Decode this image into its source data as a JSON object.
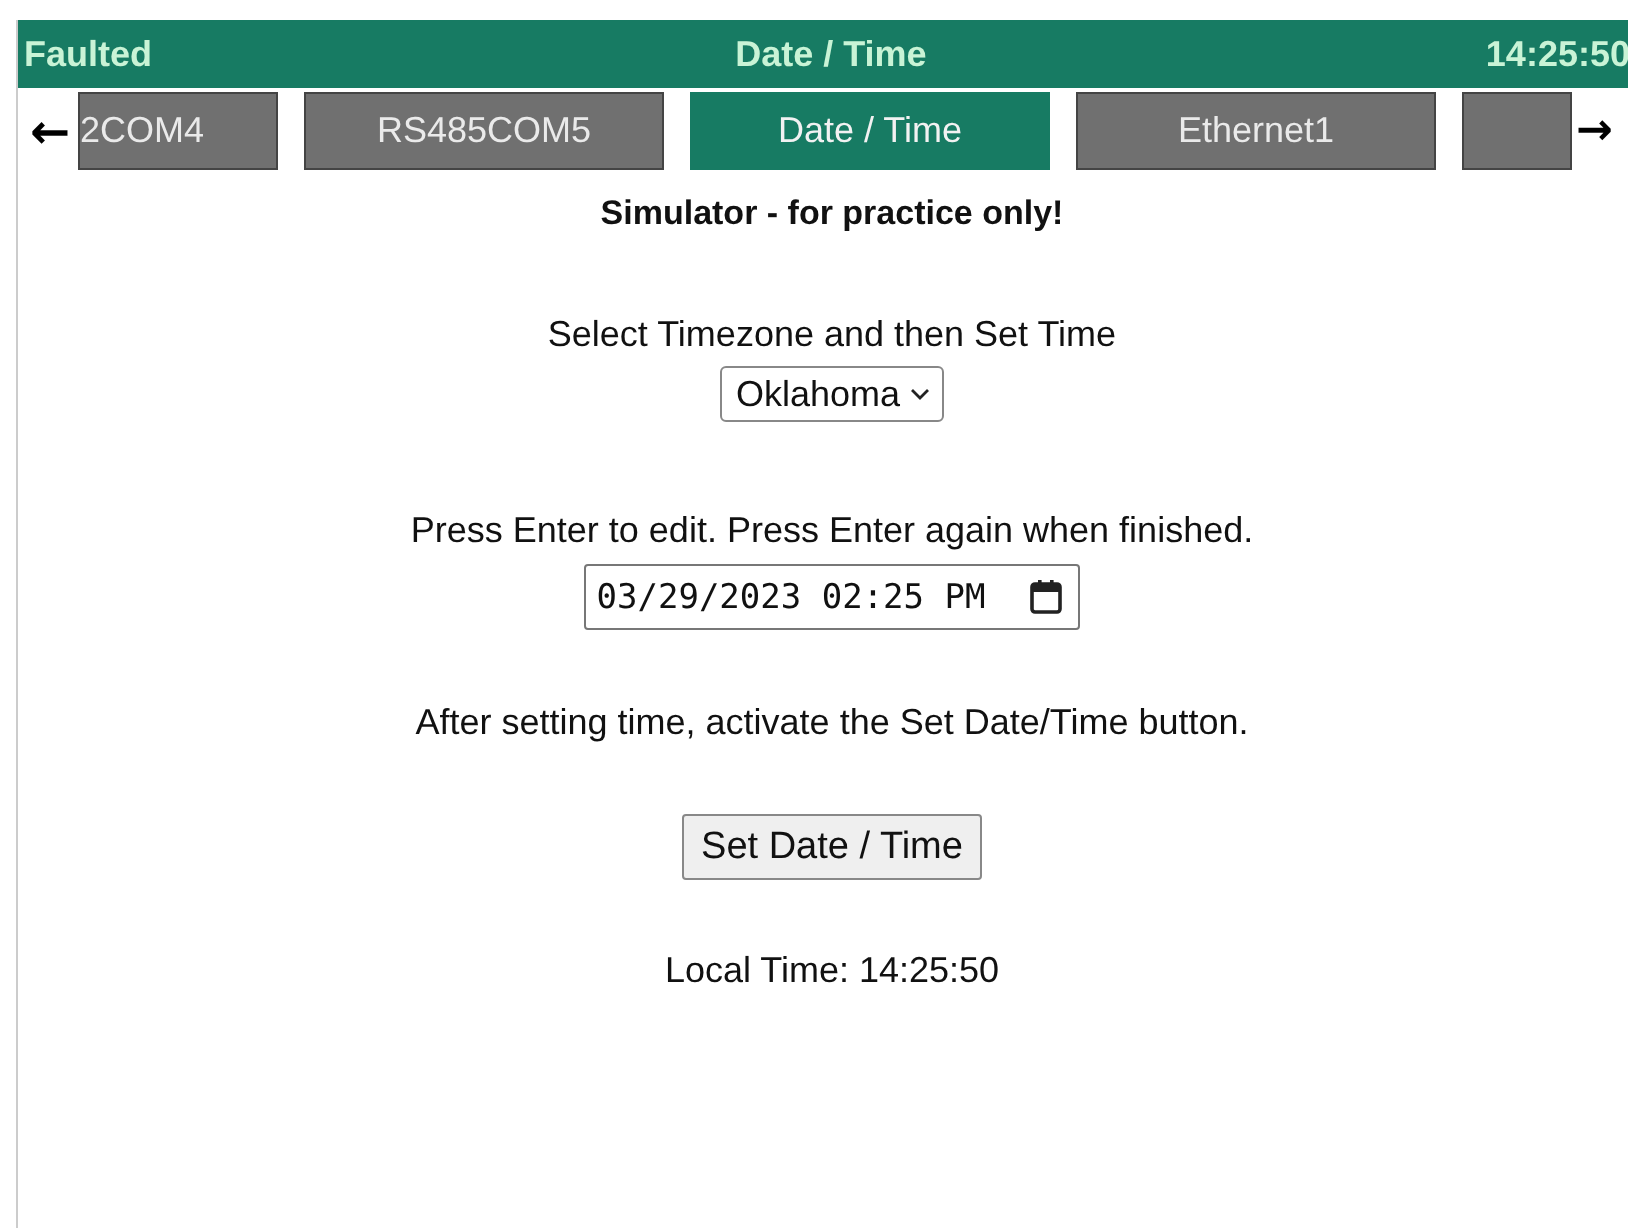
{
  "header": {
    "status": "Faulted",
    "title": "Date / Time",
    "clock": "14:25:50"
  },
  "tab_nav": {
    "prev": "←",
    "next": "→"
  },
  "tabs": [
    {
      "label": "2COM4",
      "selected": false
    },
    {
      "label": "RS485COM5",
      "selected": false
    },
    {
      "label": "Date / Time",
      "selected": true
    },
    {
      "label": "Ethernet1",
      "selected": false
    },
    {
      "selected": false
    }
  ],
  "notice": "Simulator - for practice only!",
  "timezone": {
    "label": "Select Timezone and then Set Time",
    "value": "Oklahoma"
  },
  "datetime": {
    "label": "Press Enter to edit. Press Enter again when finished.",
    "value": "03/29/2023 02:25 PM"
  },
  "instruction": "After setting time, activate the Set Date/Time button.",
  "set_button": "Set Date / Time",
  "local_time": "Local Time: 14:25:50"
}
